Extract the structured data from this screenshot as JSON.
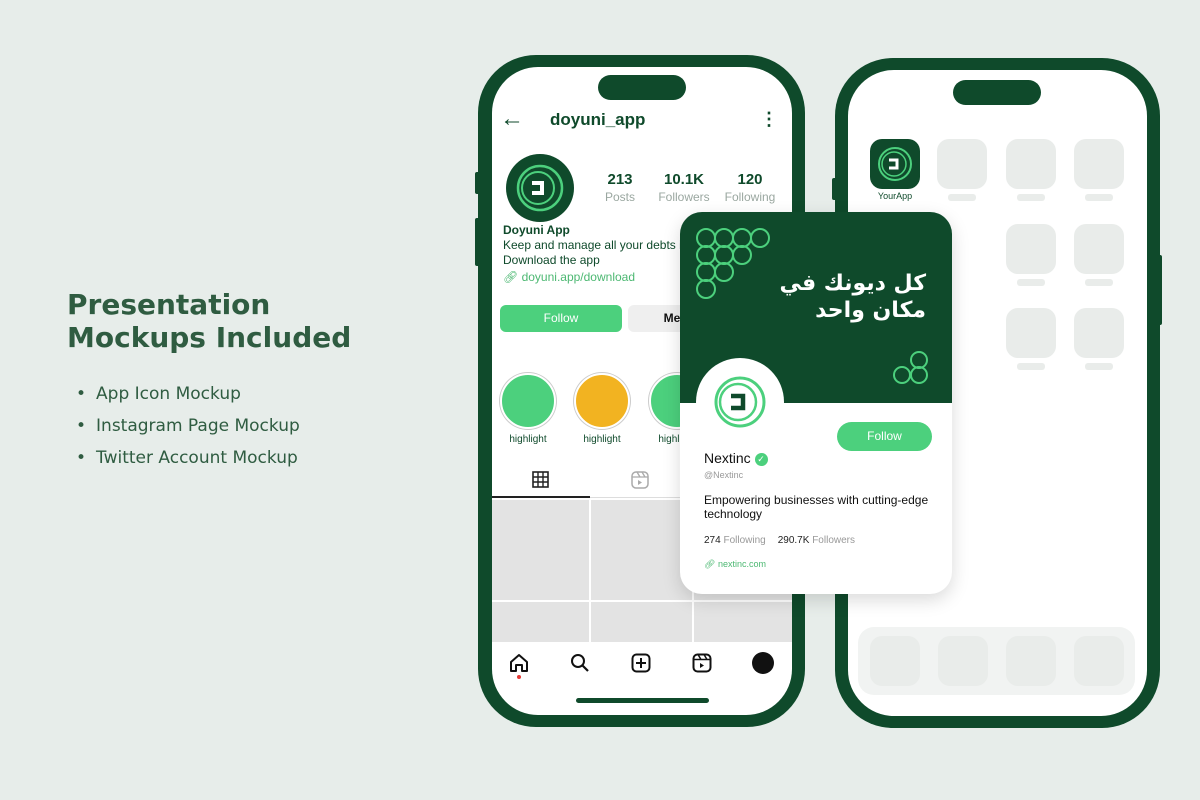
{
  "promo": {
    "title_line1": "Presentation",
    "title_line2": "Mockups Included",
    "bullets": [
      "App Icon Mockup",
      "Instagram Page Mockup",
      "Twitter Account Mockup"
    ]
  },
  "colors": {
    "dark_green": "#0f4a2b",
    "bright_green": "#4cd07d",
    "background": "#e7edea",
    "highlight_yellow": "#f2b321"
  },
  "instagram": {
    "username": "doyuni_app",
    "stats": [
      {
        "value": "213",
        "label": "Posts"
      },
      {
        "value": "10.1K",
        "label": "Followers"
      },
      {
        "value": "120",
        "label": "Following"
      }
    ],
    "name": "Doyuni App",
    "bio_line1": "Keep and manage all your debts in",
    "bio_line2": "Download the app",
    "link": "doyuni.app/download",
    "follow_label": "Follow",
    "message_label": "Message",
    "highlights": [
      "highlight",
      "highlight",
      "highlight"
    ],
    "icons": [
      "back-arrow",
      "more-vertical",
      "grid",
      "reels",
      "home",
      "search",
      "add",
      "reels",
      "profile"
    ]
  },
  "twitter": {
    "banner_text_line1": "كل ديونك في",
    "banner_text_line2": "مكان واحد",
    "name": "Nextinc",
    "handle": "@Nextinc",
    "bio": "Empowering businesses with cutting-edge technology",
    "following_count": "274",
    "following_label": "Following",
    "followers_count": "290.7K",
    "followers_label": "Followers",
    "link": "nextinc.com",
    "follow_label": "Follow"
  },
  "homescreen": {
    "app_label": "YourApp"
  }
}
